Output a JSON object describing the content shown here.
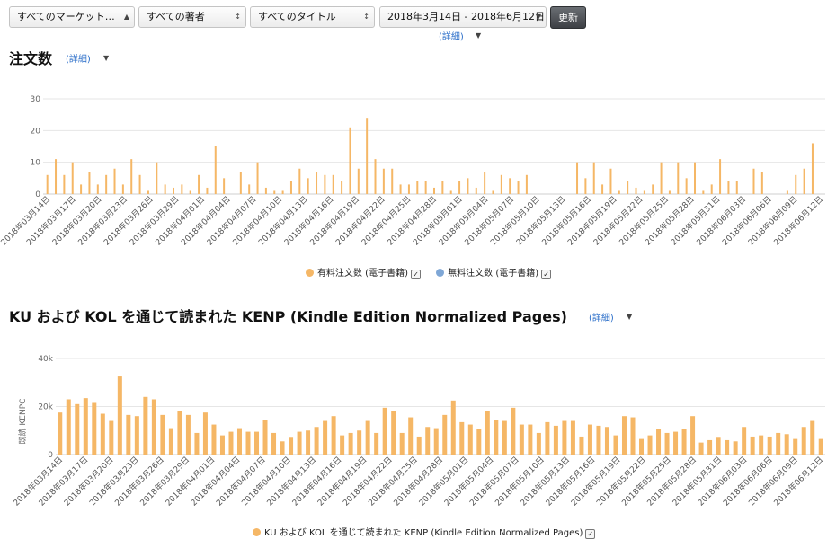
{
  "filters": {
    "marketplace": "すべてのマーケット…",
    "author": "すべての著者",
    "title": "すべてのタイトル",
    "date_range": "2018年3月14日 - 2018年6月12日",
    "update_button": "更新",
    "detail_label": "(詳細)"
  },
  "orders_section": {
    "title": "注文数",
    "detail_label": "(詳細)"
  },
  "kenp_section": {
    "title": "KU および KOL を通じて読まれた KENP (Kindle Edition Normalized Pages)",
    "detail_label": "(詳細)"
  },
  "icons": [
    "dropdown-arrow-icon",
    "caret-down-icon",
    "checkbox-checked-icon",
    "legend-dot-icon"
  ],
  "colors": {
    "paid": "#f5b766",
    "free": "#7fa7d6",
    "kenp": "#f5b766",
    "update_button": "#4a4d52",
    "link": "#2b6ec9"
  },
  "chart_data": [
    {
      "type": "bar",
      "title": "注文数",
      "ylim": [
        0,
        30
      ],
      "yticks": [
        0,
        10,
        20,
        30
      ],
      "grid": true,
      "legend_position": "bottom",
      "x_tick_labels": [
        "2018年03月14日",
        "2018年03月17日",
        "2018年03月20日",
        "2018年03月23日",
        "2018年03月26日",
        "2018年03月29日",
        "2018年04月01日",
        "2018年04月04日",
        "2018年04月07日",
        "2018年04月10日",
        "2018年04月13日",
        "2018年04月16日",
        "2018年04月19日",
        "2018年04月22日",
        "2018年04月25日",
        "2018年04月28日",
        "2018年05月01日",
        "2018年05月04日",
        "2018年05月07日",
        "2018年05月10日",
        "2018年05月13日",
        "2018年05月16日",
        "2018年05月19日",
        "2018年05月22日",
        "2018年05月25日",
        "2018年05月28日",
        "2018年05月31日",
        "2018年06月03日",
        "2018年06月06日",
        "2018年06月09日",
        "2018年06月12日"
      ],
      "series": [
        {
          "name": "有料注文数 (電子書籍)",
          "values": [
            6,
            11,
            6,
            10,
            3,
            7,
            3,
            6,
            8,
            3,
            11,
            6,
            1,
            10,
            3,
            2,
            3,
            1,
            6,
            2,
            15,
            5,
            0,
            7,
            3,
            10,
            2,
            1,
            1,
            4,
            8,
            5,
            7,
            6,
            6,
            4,
            21,
            8,
            24,
            11,
            8,
            8,
            3,
            3,
            4,
            4,
            2,
            4,
            1,
            4,
            5,
            2,
            7,
            1,
            6,
            5,
            4,
            6,
            0,
            0,
            0,
            0,
            0,
            10,
            5,
            10,
            3,
            8,
            1,
            4,
            2,
            1,
            3,
            10,
            1,
            10,
            5,
            10,
            1,
            3,
            11,
            4,
            4,
            0,
            8,
            7,
            0,
            0,
            1,
            6,
            8,
            16,
            0
          ]
        },
        {
          "name": "無料注文数 (電子書籍)",
          "values": []
        }
      ],
      "legend_checked": [
        true,
        true
      ]
    },
    {
      "type": "bar",
      "title": "KU および KOL を通じて読まれた KENP (Kindle Edition Normalized Pages)",
      "ylabel": "既読 KENPC",
      "ylim": [
        0,
        40000
      ],
      "ytick_labels": [
        "0",
        "20k",
        "40k"
      ],
      "grid": true,
      "legend_position": "bottom",
      "x_tick_labels": [
        "2018年03月14日",
        "2018年03月17日",
        "2018年03月20日",
        "2018年03月23日",
        "2018年03月26日",
        "2018年03月29日",
        "2018年04月01日",
        "2018年04月04日",
        "2018年04月07日",
        "2018年04月10日",
        "2018年04月13日",
        "2018年04月16日",
        "2018年04月19日",
        "2018年04月22日",
        "2018年04月25日",
        "2018年04月28日",
        "2018年05月01日",
        "2018年05月04日",
        "2018年05月07日",
        "2018年05月10日",
        "2018年05月13日",
        "2018年05月16日",
        "2018年05月19日",
        "2018年05月22日",
        "2018年05月25日",
        "2018年05月28日",
        "2018年05月31日",
        "2018年06月03日",
        "2018年06月06日",
        "2018年06月09日",
        "2018年06月12日"
      ],
      "series": [
        {
          "name": "KU および KOL を通じて読まれた KENP (Kindle Edition Normalized Pages)",
          "values": [
            17500,
            23000,
            21000,
            23500,
            21500,
            17000,
            14000,
            32500,
            16500,
            16000,
            24000,
            23000,
            16500,
            11000,
            18000,
            16500,
            9000,
            17500,
            12500,
            8000,
            9500,
            11000,
            9500,
            9500,
            14500,
            9000,
            5500,
            7000,
            9500,
            10000,
            11500,
            14000,
            16000,
            8000,
            9000,
            10000,
            14000,
            9000,
            19500,
            18000,
            9000,
            15500,
            7500,
            11500,
            11000,
            16500,
            22500,
            13500,
            12500,
            10500,
            18000,
            14500,
            14000,
            19500,
            12500,
            12500,
            9000,
            13500,
            12000,
            14000,
            14000,
            7500,
            12500,
            12000,
            11500,
            8000,
            16000,
            15500,
            6500,
            8000,
            10500,
            9000,
            9500,
            10500,
            16000,
            5000,
            6000,
            7000,
            6000,
            5500,
            11500,
            7500,
            8000,
            7500,
            9000,
            8500,
            6500,
            11500,
            14000,
            6500
          ]
        }
      ],
      "legend_checked": [
        true
      ]
    }
  ]
}
